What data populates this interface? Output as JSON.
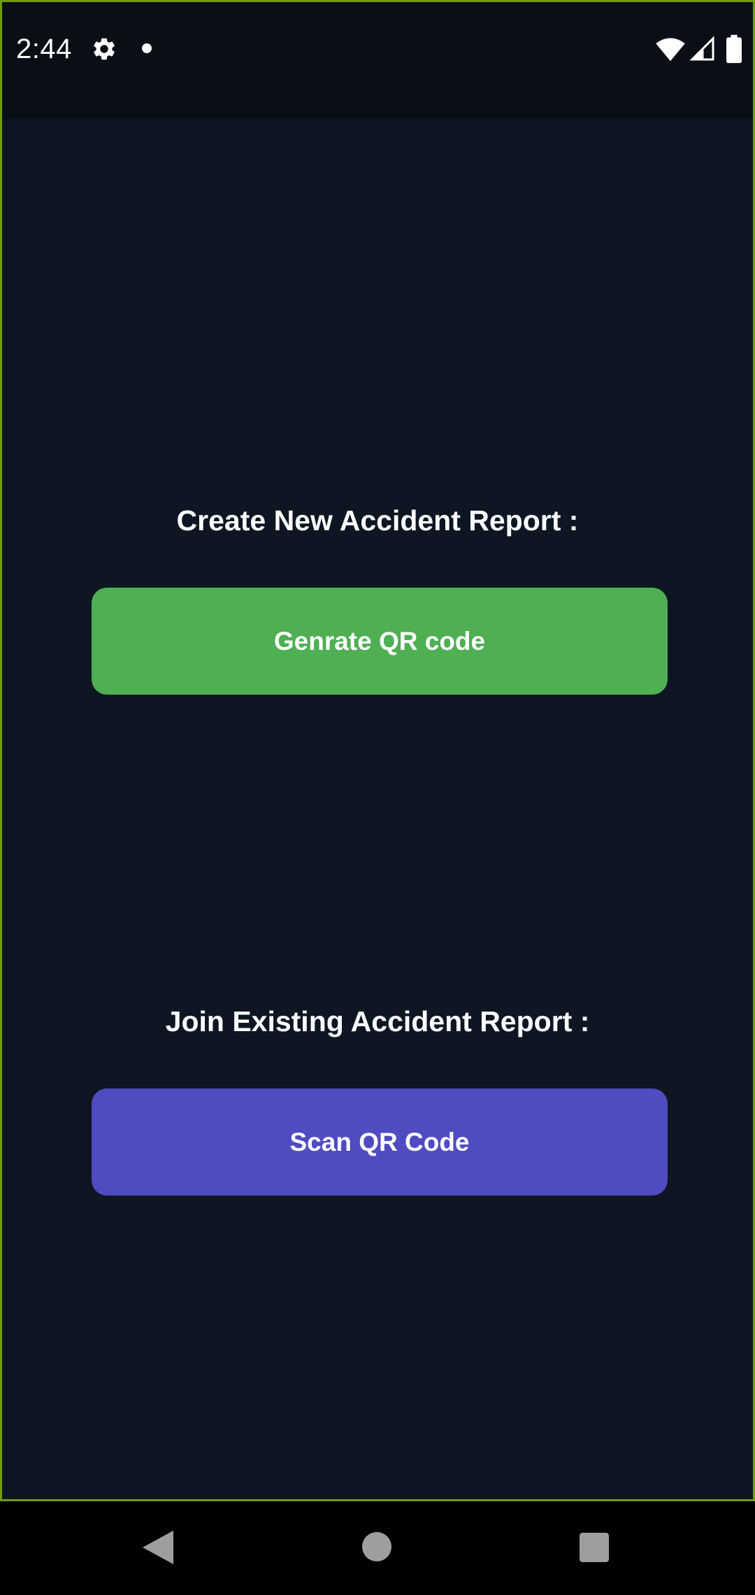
{
  "status_bar": {
    "time": "2:44",
    "icons": [
      "gear-icon",
      "notification-dot-icon",
      "wifi-icon",
      "cell-signal-icon",
      "battery-icon"
    ]
  },
  "main": {
    "create_label": "Create New Accident Report :",
    "generate_button_label": "Genrate QR code",
    "join_label": "Join Existing Accident Report :",
    "scan_button_label": "Scan QR Code"
  },
  "navigation_bar": {
    "icons": [
      "back-icon",
      "home-icon",
      "recents-icon"
    ]
  },
  "colors": {
    "background": "#0d1622",
    "status_bar": "#0a0f17",
    "generate_button": "#4eaf53",
    "scan_button": "#4f4bc1",
    "frame_border": "#6f9a14",
    "text": "#ffffff"
  }
}
